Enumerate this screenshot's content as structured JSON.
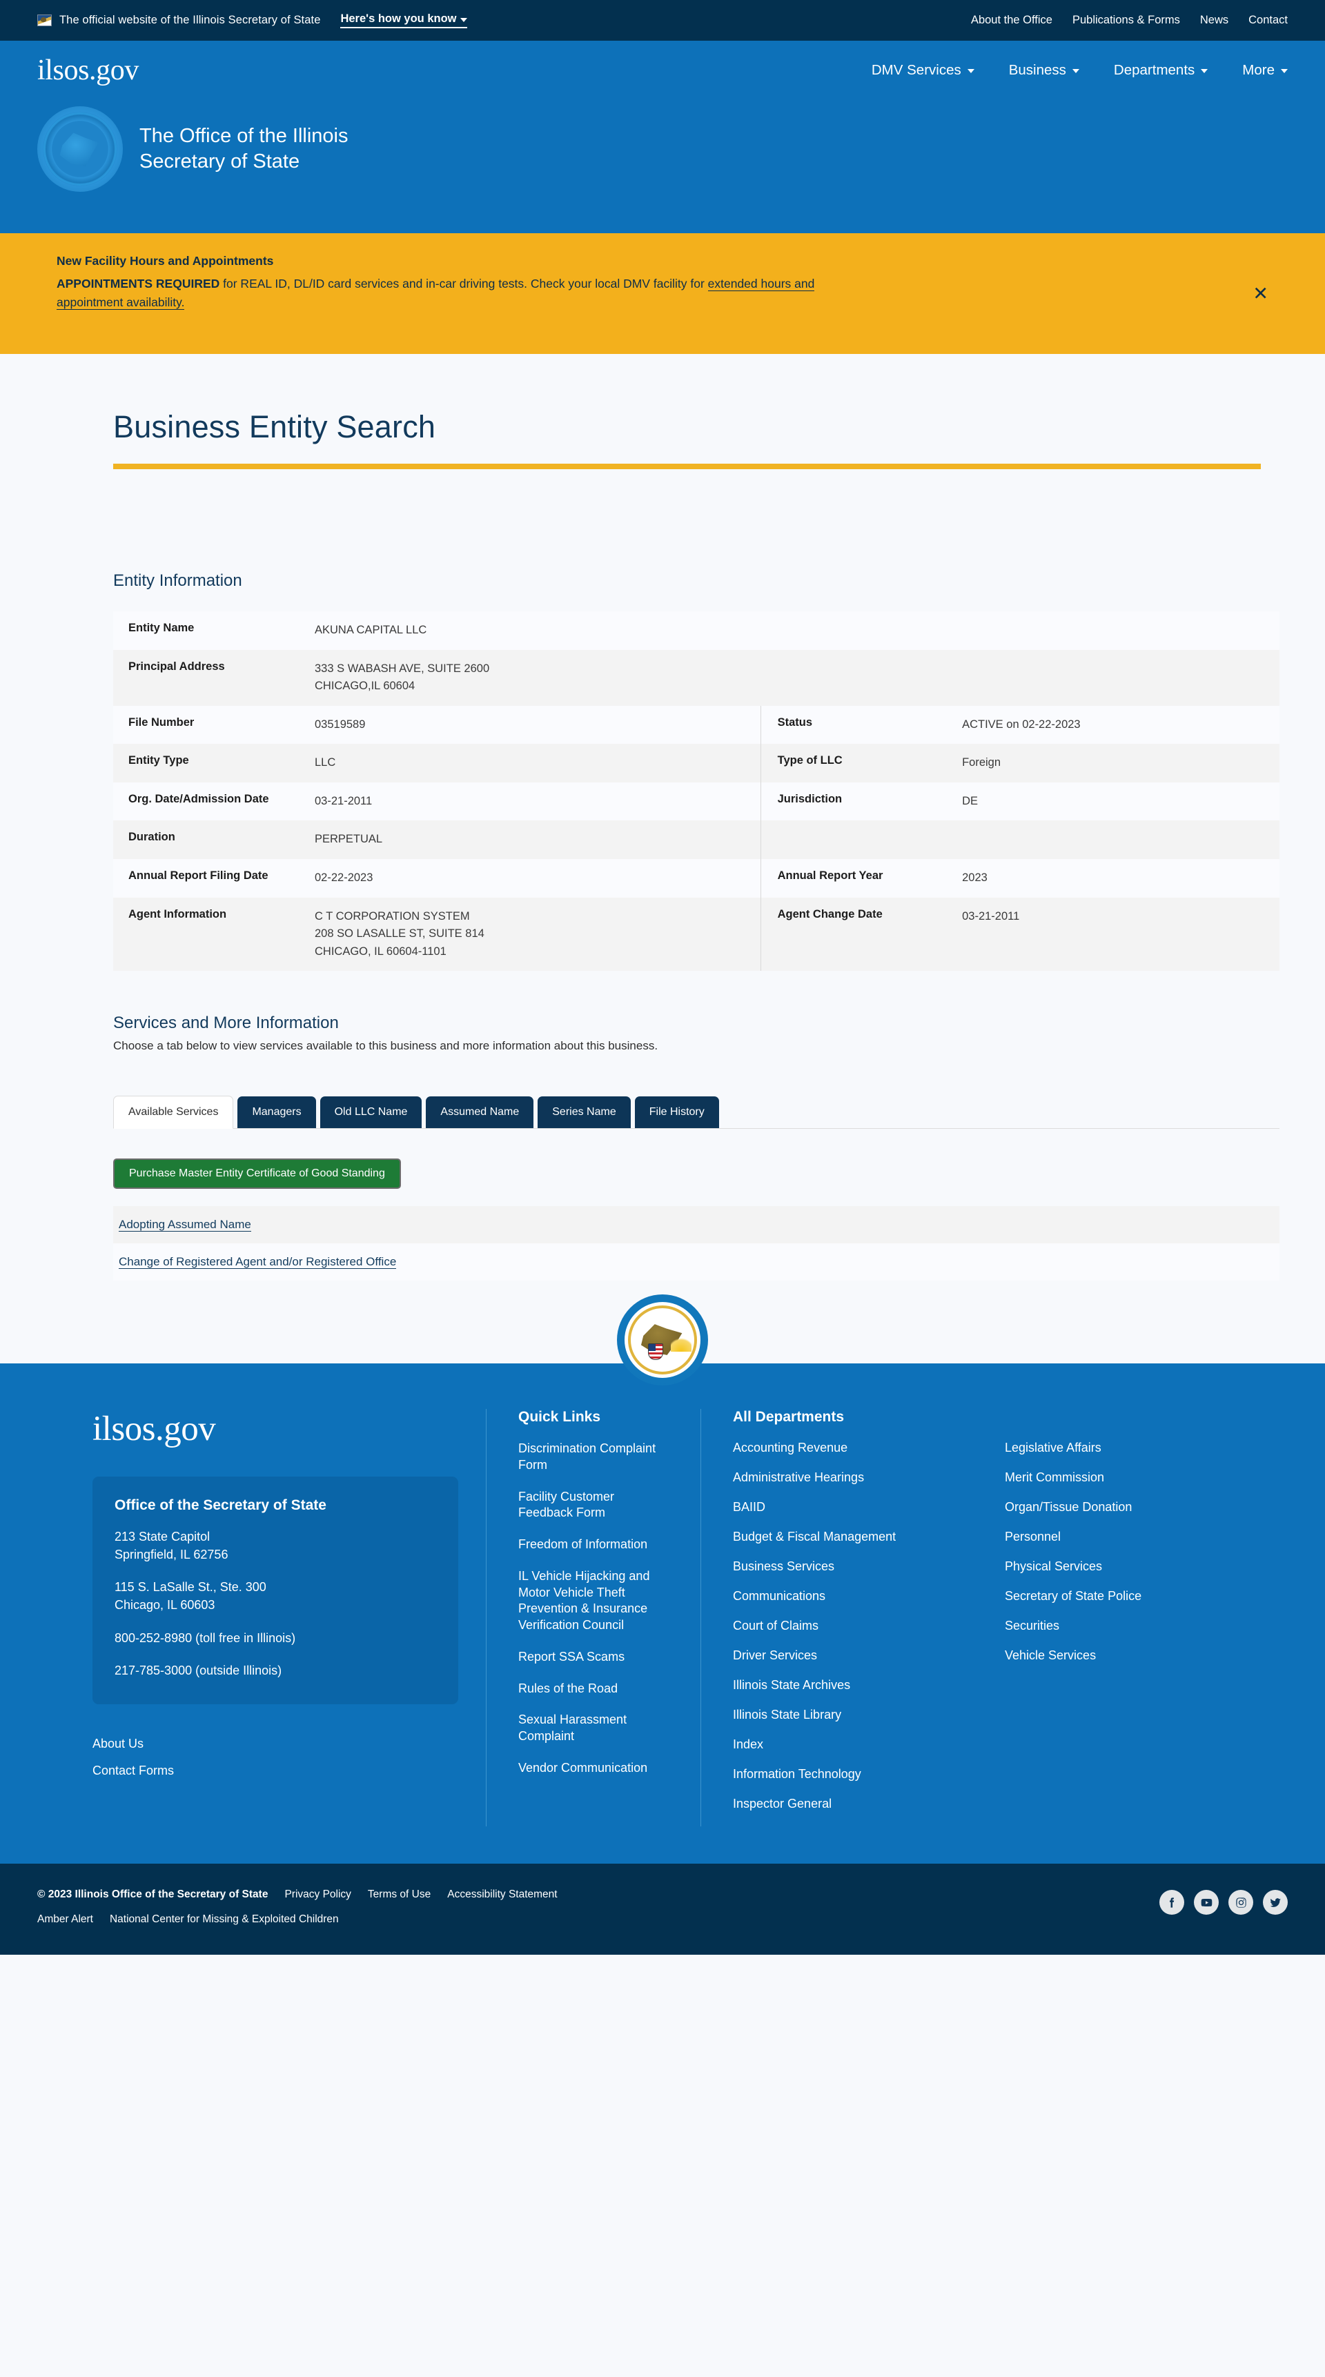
{
  "utility_bar": {
    "flag_icon": "illinois-flag-icon",
    "official_text": "The official website of the Illinois Secretary of State",
    "how_you_know": "Here's how you know",
    "links": [
      "About the Office",
      "Publications & Forms",
      "News",
      "Contact"
    ]
  },
  "header": {
    "logo": "ilsos.gov",
    "nav": [
      {
        "label": "DMV Services",
        "has_caret": true
      },
      {
        "label": "Business",
        "has_caret": true
      },
      {
        "label": "Departments",
        "has_caret": true
      },
      {
        "label": "More",
        "has_caret": true
      }
    ],
    "office_title_line1": "The Office of the Illinois",
    "office_title_line2": "Secretary of State"
  },
  "alert": {
    "title": "New Facility Hours and Appointments",
    "bold_lead": "APPOINTMENTS REQUIRED",
    "body_1": " for REAL ID, DL/ID card services and in-car driving tests. Check your local DMV facility for ",
    "link_text_1": "extended hours and",
    "link_text_2": "appointment availability.",
    "close_label": "✕"
  },
  "page": {
    "title": "Business Entity Search",
    "entity_information_label": "Entity Information"
  },
  "entity": {
    "rows": [
      {
        "label": "Entity Name",
        "value": "AKUNA CAPITAL LLC",
        "label2": "",
        "value2": ""
      },
      {
        "label": "Principal Address",
        "value": "333 S WABASH AVE, SUITE 2600\nCHICAGO,IL 60604",
        "label2": "",
        "value2": ""
      },
      {
        "label": "File Number",
        "value": "03519589",
        "label2": "Status",
        "value2": "ACTIVE on 02-22-2023"
      },
      {
        "label": "Entity Type",
        "value": "LLC",
        "label2": "Type of LLC",
        "value2": "Foreign"
      },
      {
        "label": "Org. Date/Admission Date",
        "value": "03-21-2011",
        "label2": "Jurisdiction",
        "value2": "DE"
      },
      {
        "label": "Duration",
        "value": "PERPETUAL",
        "label2": "",
        "value2": ""
      },
      {
        "label": "Annual Report Filing Date",
        "value": "02-22-2023",
        "label2": "Annual Report Year",
        "value2": "2023"
      },
      {
        "label": "Agent Information",
        "value": "C T CORPORATION SYSTEM\n208 SO LASALLE ST, SUITE 814\nCHICAGO, IL 60604-1101",
        "label2": "Agent Change Date",
        "value2": "03-21-2011"
      }
    ]
  },
  "services": {
    "heading": "Services and More Information",
    "subheading": "Choose a tab below to view services available to this business and more information about this business.",
    "tabs": [
      {
        "label": "Available Services",
        "active": true
      },
      {
        "label": "Managers",
        "active": false
      },
      {
        "label": "Old LLC Name",
        "active": false
      },
      {
        "label": "Assumed Name",
        "active": false
      },
      {
        "label": "Series Name",
        "active": false
      },
      {
        "label": "File History",
        "active": false
      }
    ],
    "purchase_button": "Purchase Master Entity Certificate of Good Standing",
    "links": [
      "Adopting Assumed Name",
      "Change of Registered Agent and/or Registered Office"
    ]
  },
  "footer": {
    "seal_icon": "illinois-state-seal-icon",
    "logo": "ilsos.gov",
    "address_card": {
      "title": "Office of the Secretary of State",
      "lines": [
        "213 State Capitol\nSpringfield, IL 62756",
        "115 S. LaSalle St., Ste. 300\nChicago, IL 60603",
        "800-252-8980 (toll free in Illinois)",
        "217-785-3000 (outside Illinois)"
      ]
    },
    "extra_links": [
      "About Us",
      "Contact Forms"
    ],
    "quick_links_heading": "Quick Links",
    "quick_links": [
      "Discrimination Complaint Form",
      "Facility Customer Feedback Form",
      "Freedom of Information",
      "IL Vehicle Hijacking and Motor Vehicle Theft Prevention & Insurance Verification Council",
      "Report SSA Scams",
      "Rules of the Road",
      "Sexual Harassment Complaint",
      "Vendor Communication"
    ],
    "departments_heading": "All Departments",
    "departments_col1": [
      "Accounting Revenue",
      "Administrative Hearings",
      "BAIID",
      "Budget & Fiscal Management",
      "Business Services",
      "Communications",
      "Court of Claims",
      "Driver Services",
      "Illinois State Archives",
      "Illinois State Library",
      "Index",
      "Information Technology",
      "Inspector General"
    ],
    "departments_col2": [
      "Legislative Affairs",
      "Merit Commission",
      "Organ/Tissue Donation",
      "Personnel",
      "Physical Services",
      "Secretary of State Police",
      "Securities",
      "Vehicle Services"
    ]
  },
  "bottom": {
    "copyright": "© 2023 Illinois Office of the Secretary of State",
    "links_row1": [
      "Privacy Policy",
      "Terms of Use",
      "Accessibility Statement"
    ],
    "links_row2": [
      "Amber Alert",
      "National Center for Missing & Exploited Children"
    ],
    "social": [
      "facebook-icon",
      "youtube-icon",
      "instagram-icon",
      "twitter-icon"
    ]
  },
  "colors": {
    "navy": "#03304f",
    "blue": "#0d71b9",
    "gold": "#f3b01c",
    "green": "#1e7b36",
    "tab_navy": "#0d3557"
  }
}
